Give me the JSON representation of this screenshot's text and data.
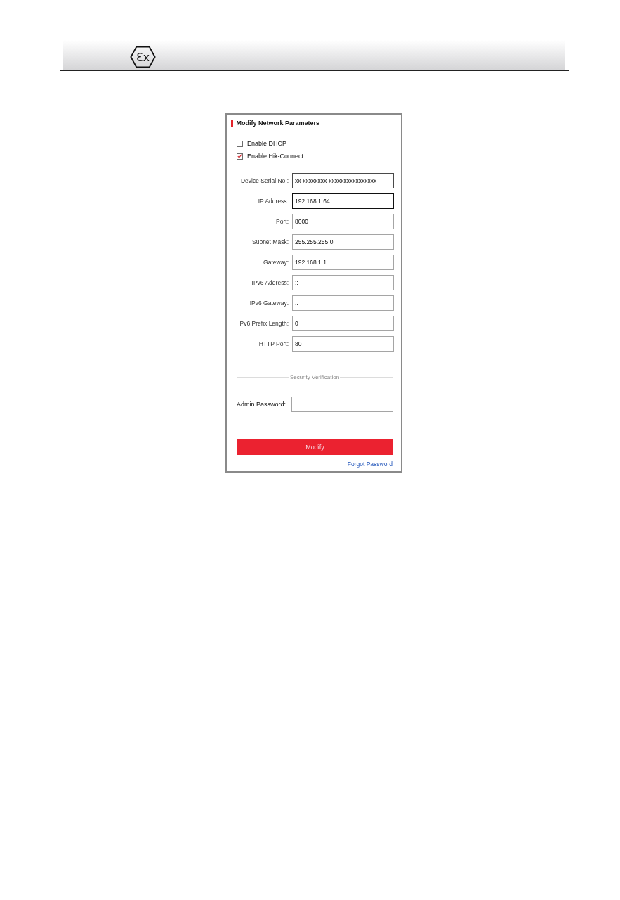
{
  "header": {
    "logo_text": "Ɛx"
  },
  "panel": {
    "title": "Modify Network Parameters",
    "checkboxes": [
      {
        "label": "Enable DHCP",
        "checked": false
      },
      {
        "label": "Enable Hik-Connect",
        "checked": true
      }
    ],
    "fields": [
      {
        "label": "Device Serial No.:",
        "value": "xx-xxxxxxxx-xxxxxxxxxxxxxxxx",
        "focused": false,
        "readonly": true
      },
      {
        "label": "IP Address:",
        "value": "192.168.1.64",
        "focused": true,
        "readonly": false
      },
      {
        "label": "Port:",
        "value": "8000",
        "focused": false,
        "readonly": false
      },
      {
        "label": "Subnet Mask:",
        "value": "255.255.255.0",
        "focused": false,
        "readonly": false
      },
      {
        "label": "Gateway:",
        "value": "192.168.1.1",
        "focused": false,
        "readonly": false
      },
      {
        "label": "IPv6 Address:",
        "value": "::",
        "focused": false,
        "readonly": false
      },
      {
        "label": "IPv6 Gateway:",
        "value": "::",
        "focused": false,
        "readonly": false
      },
      {
        "label": "IPv6 Prefix Length:",
        "value": "0",
        "focused": false,
        "readonly": false
      },
      {
        "label": "HTTP Port:",
        "value": "80",
        "focused": false,
        "readonly": false
      }
    ],
    "security_section": {
      "title": "Security Verification",
      "password_label": "Admin Password:"
    },
    "button": "Modify",
    "link": "Forgot Password"
  }
}
